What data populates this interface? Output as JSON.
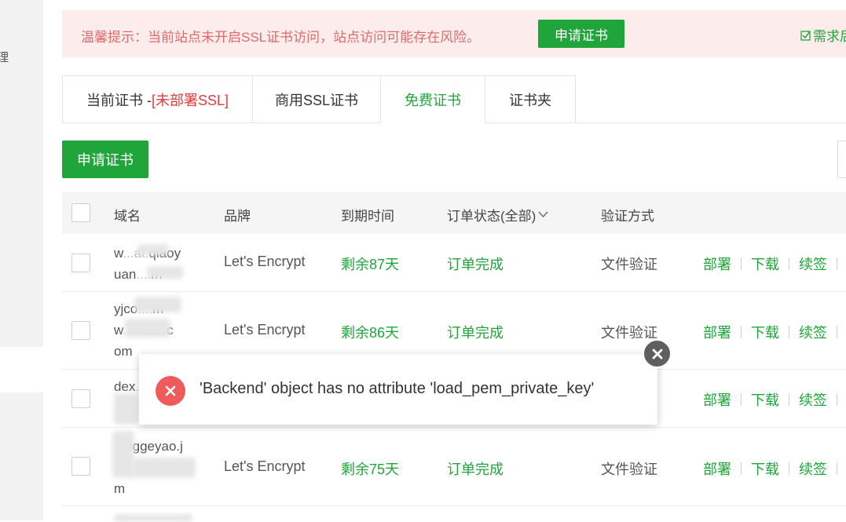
{
  "sidebar": {
    "fragment": "理"
  },
  "banner": {
    "text": "温馨提示：当前站点未开启SSL证书访问，站点访问可能存在风险。",
    "apply_label": "申请证书",
    "link_label": "需求后"
  },
  "tabs": [
    {
      "label": "当前证书 -",
      "extra": "[未部署SSL]"
    },
    {
      "label": "商用SSL证书"
    },
    {
      "label": "免费证书"
    },
    {
      "label": "证书夹"
    }
  ],
  "apply_button": "申请证书",
  "table": {
    "headers": [
      "域名",
      "品牌",
      "到期时间",
      "订单状态(全部)",
      "验证方式"
    ],
    "rows": [
      {
        "domain": "w...at.qiaoy\nuan....m",
        "brand": "Let's Encrypt",
        "expire": "剩余87天",
        "status": "订单完成",
        "verify": "文件验证"
      },
      {
        "domain": "yjco....m\nw....oco.c\nom",
        "brand": "Let's Encrypt",
        "expire": "剩余86天",
        "status": "订单完成",
        "verify": "文件验证"
      },
      {
        "domain": "dex...",
        "brand": "",
        "expire": "",
        "status": "",
        "verify": ""
      },
      {
        "domain": "...nggeyao.j\n...\nm",
        "brand": "Let's Encrypt",
        "expire": "剩余75天",
        "status": "订单完成",
        "verify": "文件验证"
      }
    ],
    "actions": [
      "部署",
      "下载",
      "续签"
    ]
  },
  "toast": {
    "message": "'Backend' object has no attribute 'load_pem_private_key'"
  },
  "colors": {
    "accent": "#20a53a",
    "danger": "#ef5a5a",
    "banner_bg": "#fdecec"
  }
}
